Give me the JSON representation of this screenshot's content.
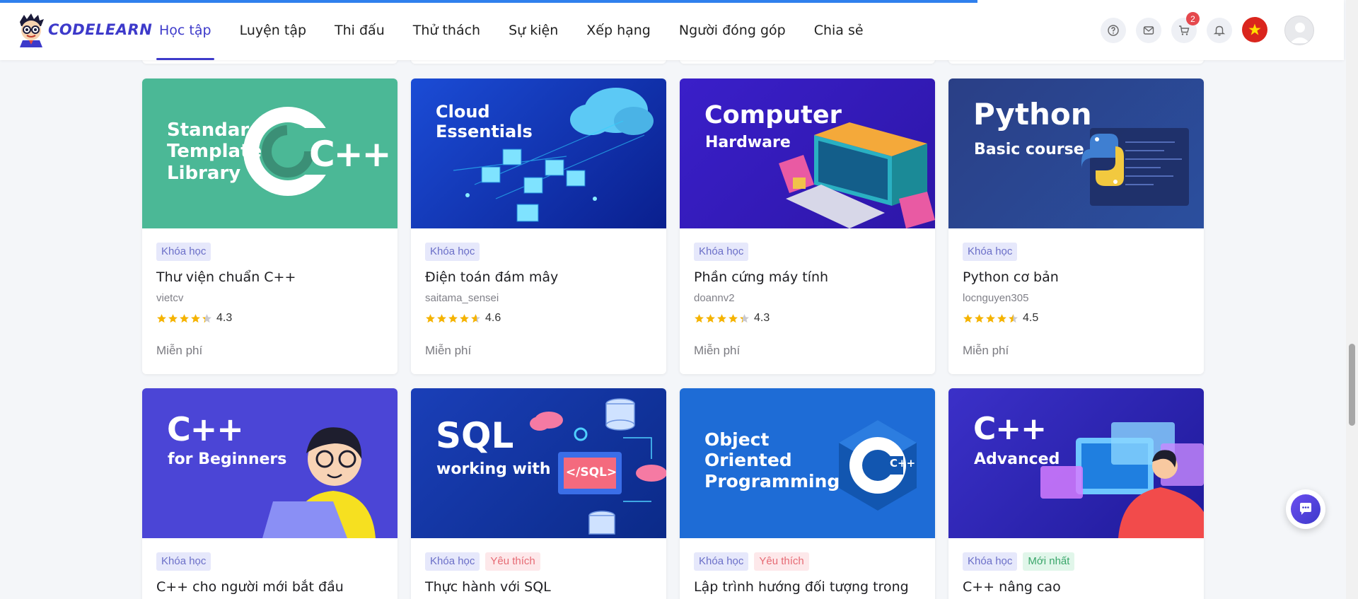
{
  "brand": {
    "name": "CODELEARN"
  },
  "page_progress": 0.72,
  "nav": [
    {
      "label": "Học tập",
      "active": true
    },
    {
      "label": "Luyện tập"
    },
    {
      "label": "Thi đấu"
    },
    {
      "label": "Thử thách"
    },
    {
      "label": "Sự kiện"
    },
    {
      "label": "Xếp hạng"
    },
    {
      "label": "Người đóng góp"
    },
    {
      "label": "Chia sẻ"
    }
  ],
  "header_icons": {
    "help": "help-icon",
    "mail": "mail-icon",
    "cart": "cart-icon",
    "cart_count": "2",
    "notifications": "bell-icon",
    "language": "vietnam-flag-icon",
    "avatar": "user-avatar"
  },
  "colors": {
    "accent": "#3d3aca",
    "badge": "#e5484d",
    "star": "#f5b301"
  },
  "cards": [
    {
      "thumb_lines": [
        "Standard",
        "Template",
        "Library"
      ],
      "thumb_logo": "C++",
      "tags": [
        "Khóa học"
      ],
      "name": "Thư viện chuẩn C++",
      "author": "vietcv",
      "rating": 4.3,
      "rating_text": "4.3",
      "price": "Miễn phí"
    },
    {
      "thumb_lines": [
        "Cloud",
        "Essentials"
      ],
      "tags": [
        "Khóa học"
      ],
      "name": "Điện toán đám mây",
      "author": "saitama_sensei",
      "rating": 4.6,
      "rating_text": "4.6",
      "price": "Miễn phí"
    },
    {
      "thumb_lines": [
        "Computer",
        "Hardware"
      ],
      "tags": [
        "Khóa học"
      ],
      "name": "Phần cứng máy tính",
      "author": "doannv2",
      "rating": 4.3,
      "rating_text": "4.3",
      "price": "Miễn phí"
    },
    {
      "thumb_lines": [
        "Python",
        "Basic course"
      ],
      "tags": [
        "Khóa học"
      ],
      "name": "Python cơ bản",
      "author": "locnguyen305",
      "rating": 4.5,
      "rating_text": "4.5",
      "price": "Miễn phí"
    },
    {
      "thumb_lines": [
        "C++",
        "for Beginners"
      ],
      "tags": [
        "Khóa học"
      ],
      "name": "C++ cho người mới bắt đầu"
    },
    {
      "thumb_lines": [
        "SQL",
        "working with"
      ],
      "thumb_badge": "</SQL>",
      "tags": [
        "Khóa học",
        "Yêu thích"
      ],
      "name": "Thực hành với SQL"
    },
    {
      "thumb_lines": [
        "Object",
        "Oriented",
        "Programming"
      ],
      "thumb_logo": "C++",
      "tags": [
        "Khóa học",
        "Yêu thích"
      ],
      "name": "Lập trình hướng đối tượng trong"
    },
    {
      "thumb_lines": [
        "C++",
        "Advanced"
      ],
      "tags": [
        "Khóa học",
        "Mới nhất"
      ],
      "name": "C++ nâng cao"
    }
  ],
  "chat": {
    "icon": "chat-icon"
  }
}
